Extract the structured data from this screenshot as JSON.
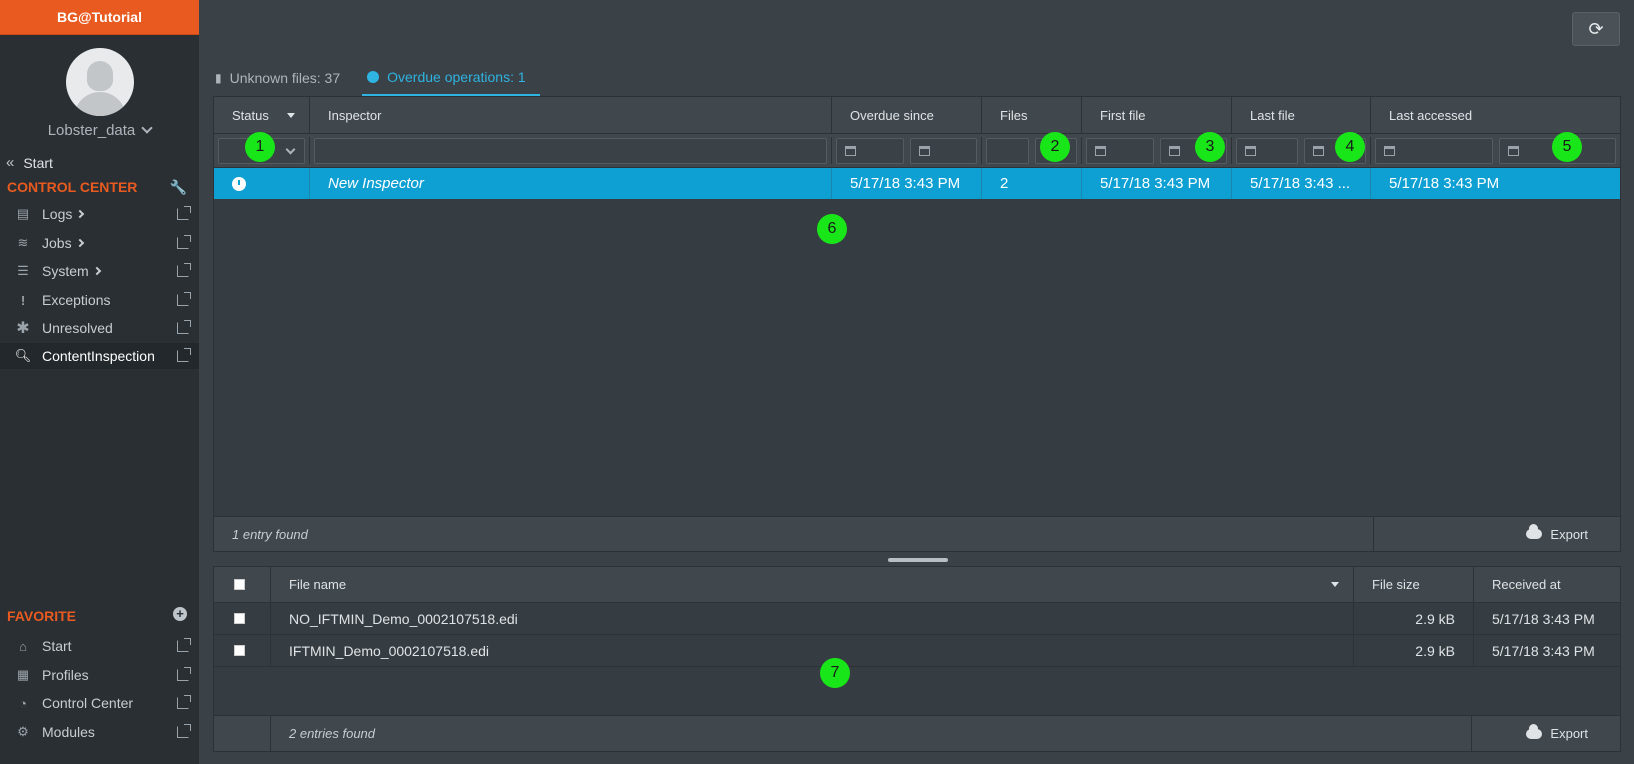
{
  "app": {
    "brand": "BG@Tutorial"
  },
  "user": {
    "name": "Lobster_data"
  },
  "nav": {
    "start_label": "Start",
    "control_center_title": "CONTROL CENTER",
    "items": [
      {
        "label": "Logs",
        "icon": "document-icon",
        "has_submenu": true
      },
      {
        "label": "Jobs",
        "icon": "jobs-icon",
        "has_submenu": true
      },
      {
        "label": "System",
        "icon": "server-icon",
        "has_submenu": true
      },
      {
        "label": "Exceptions",
        "icon": "exclamation-icon",
        "has_submenu": false
      },
      {
        "label": "Unresolved",
        "icon": "asterisk-icon",
        "has_submenu": false
      },
      {
        "label": "ContentInspection",
        "icon": "magnifier-icon",
        "has_submenu": false,
        "active": true
      }
    ],
    "favorite_title": "FAVORITE",
    "favorites": [
      {
        "label": "Start",
        "icon": "home-icon"
      },
      {
        "label": "Profiles",
        "icon": "chip-icon"
      },
      {
        "label": "Control Center",
        "icon": "dashboard-icon"
      },
      {
        "label": "Modules",
        "icon": "gears-icon"
      }
    ]
  },
  "tabs": [
    {
      "label": "Unknown files: 37",
      "icon": "file-icon",
      "active": false
    },
    {
      "label": "Overdue operations: 1",
      "icon": "clock-icon",
      "active": true
    }
  ],
  "upper_table": {
    "columns": [
      "Status",
      "Inspector",
      "Overdue since",
      "Files",
      "First file",
      "Last file",
      "Last accessed"
    ],
    "sorted_column": "Status",
    "rows": [
      {
        "status_icon": "clock-icon",
        "inspector": "New Inspector",
        "overdue_since": "5/17/18 3:43 PM",
        "files": "2",
        "first_file": "5/17/18 3:43 PM",
        "last_file": "5/17/18 3:43 ...",
        "last_accessed": "5/17/18 3:43 PM",
        "selected": true
      }
    ],
    "footer_info": "1 entry found",
    "export_label": "Export"
  },
  "lower_table": {
    "columns": [
      "File name",
      "File size",
      "Received at"
    ],
    "sorted_column": "File name",
    "rows": [
      {
        "file_name": "NO_IFTMIN_Demo_0002107518.edi",
        "file_size": "2.9 kB",
        "received_at": "5/17/18 3:43 PM"
      },
      {
        "file_name": "IFTMIN_Demo_0002107518.edi",
        "file_size": "2.9 kB",
        "received_at": "5/17/18 3:43 PM"
      }
    ],
    "footer_info": "2 entries found",
    "export_label": "Export"
  },
  "markers": [
    "1",
    "2",
    "3",
    "4",
    "5",
    "6",
    "7"
  ],
  "colors": {
    "accent": "#e85a1f",
    "selection": "#0ea0d3",
    "tab_active": "#2fb3e0",
    "marker": "#19e619"
  }
}
